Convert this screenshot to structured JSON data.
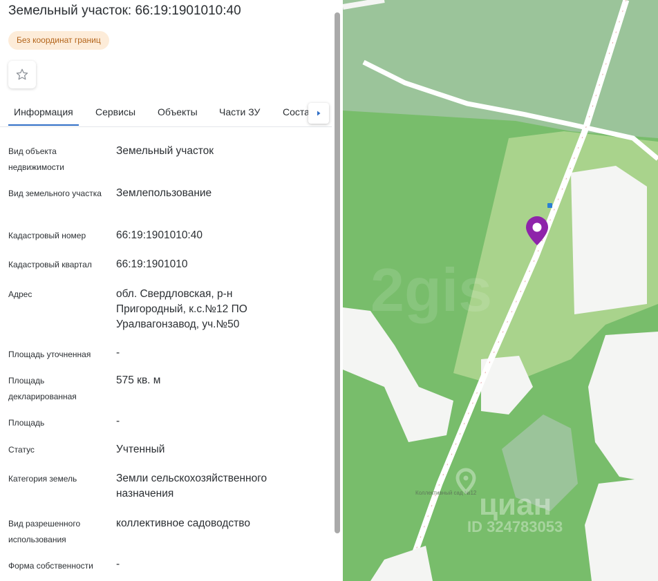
{
  "header": {
    "title": "Земельный участок: 66:19:1901010:40",
    "badge": "Без координат границ"
  },
  "icons": {
    "favorite": "star-icon",
    "tabs_next": "chevron-right-icon",
    "map_marker": "location-pin-icon"
  },
  "tabs": [
    {
      "label": "Информация",
      "active": true
    },
    {
      "label": "Сервисы"
    },
    {
      "label": "Объекты"
    },
    {
      "label": "Части ЗУ"
    },
    {
      "label": "Соста"
    }
  ],
  "fields": {
    "object_type": {
      "label": "Вид объекта недвижимости",
      "value": "Земельный участок"
    },
    "land_type": {
      "label": "Вид земельного участка",
      "value": "Землепользование"
    },
    "cadastral_number": {
      "label": "Кадастровый номер",
      "value": "66:19:1901010:40"
    },
    "cadastral_block": {
      "label": "Кадастровый квартал",
      "value": "66:19:1901010"
    },
    "address": {
      "label": "Адрес",
      "value": "обл. Свердловская, р-н Пригородный, к.с.№12 ПО Уралвагонзавод, уч.№50"
    },
    "area_specified": {
      "label": "Площадь уточненная",
      "value": "-"
    },
    "area_declared": {
      "label": "Площадь декларированная",
      "value": "575 кв. м"
    },
    "area": {
      "label": "Площадь",
      "value": "-"
    },
    "status": {
      "label": "Статус",
      "value": "Учтенный"
    },
    "land_category": {
      "label": "Категория земель",
      "value": "Земли сельскохозяйственного назначения"
    },
    "permitted_use": {
      "label": "Вид разрешенного использования",
      "value": "коллективное садоводство"
    },
    "ownership": {
      "label": "Форма собственности",
      "value": "-"
    }
  },
  "map": {
    "label_settlement": "Коллективный сад №12",
    "watermark_brand": "циан",
    "watermark_id": "ID 324783053",
    "watermark_faint": "2gis",
    "colors": {
      "forest": "#78bd6b",
      "field": "#a9d38c",
      "meadow": "#9bc49a",
      "clearing": "#f4f5f3",
      "road": "#ffffff",
      "marker": "#8e24aa"
    }
  }
}
